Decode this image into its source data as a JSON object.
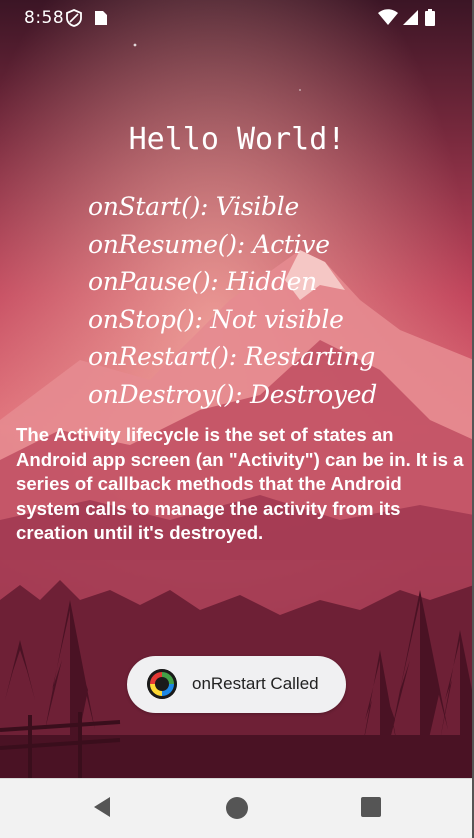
{
  "status_bar": {
    "time": "8:58",
    "left_icons": [
      "shield-icon",
      "sim-card-icon"
    ],
    "right_icons": [
      "wifi-icon",
      "signal-icon",
      "battery-icon"
    ]
  },
  "app": {
    "title": "Hello World!",
    "lifecycle_states": [
      "onStart(): Visible",
      "onResume(): Active",
      "onPause(): Hidden",
      "onStop(): Not visible",
      "onRestart(): Restarting",
      "onDestroy(): Destroyed"
    ],
    "description": "The Activity lifecycle is the set of states an Android app screen (an \"Activity\") can be in. It is a series of callback methods that the Android system calls to manage the activity from its creation until it's destroyed."
  },
  "toast": {
    "message": "onRestart Called",
    "icon": "app-logo-icon"
  },
  "nav_bar": {
    "buttons": [
      "back-icon",
      "home-icon",
      "recents-icon"
    ]
  },
  "colors": {
    "sky_top": "#3b1525",
    "sky_mid": "#c2455c",
    "sky_glow": "#f0a09a",
    "mountain": "#e08a90",
    "forest": "#5c1a2c",
    "text": "#ffffff",
    "toast_bg": "#f0f0f2",
    "nav_bg": "#f2f2f2"
  }
}
